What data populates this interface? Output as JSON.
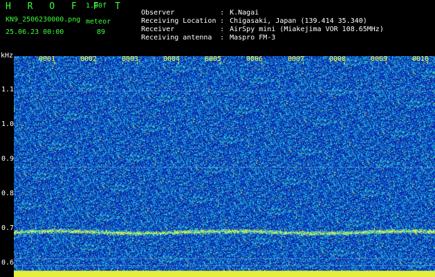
{
  "header": {
    "title": "H R O F F T",
    "version": "1.00f",
    "filename": "KN9_2506230000.png",
    "meteor_label": "meteor",
    "datetime": "25.06.23 00:00",
    "meteor_count": "89"
  },
  "info": [
    {
      "key": "Observer",
      "value": "K.Nagai"
    },
    {
      "key": "Receiving Location",
      "value": "Chigasaki, Japan (139.414 35.340)"
    },
    {
      "key": "Receiver",
      "value": "AirSpy mini (Miakejima VOR 108.65MHz)"
    },
    {
      "key": "Receiving antenna",
      "value": "Maspro FM-3"
    }
  ],
  "axis": {
    "y_unit": "kHz",
    "y_ticks": [
      "1.1",
      "1.0",
      "0.9",
      "0.8",
      "0.7",
      "0.6"
    ],
    "x_ticks": [
      "0001",
      "0002",
      "0003",
      "0004",
      "0005",
      "0006",
      "0007",
      "0008",
      "0009",
      "0010"
    ]
  },
  "colors": {
    "background": "#0a2a9a",
    "header_green": "#3cff3c",
    "tick_yellow": "#ffff33"
  }
}
